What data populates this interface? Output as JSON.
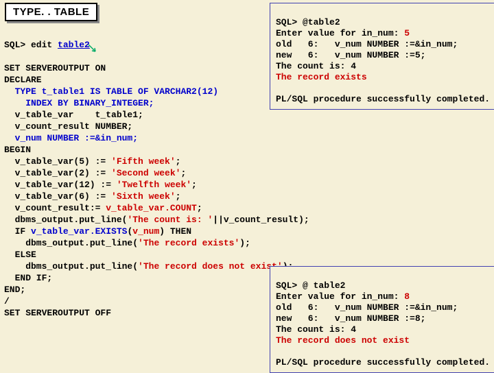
{
  "title": "TYPE. . TABLE",
  "edit_line_prefix": "SQL> edit ",
  "edit_link": "table2",
  "code": {
    "l1": "SET SERVEROUTPUT ON",
    "l2": "DECLARE",
    "l3a": "  TYPE t_table1 IS TABLE OF VARCHAR2(12)",
    "l4": "    INDEX BY BINARY_INTEGER;",
    "l5": "  v_table_var    t_table1;",
    "l6": "  v_count_result NUMBER;",
    "l7": "  v_num NUMBER :=&in_num;",
    "l8": "BEGIN",
    "l9a": "  v_table_var(5) := ",
    "l9b": "'Fifth week'",
    "l10a": "  v_table_var(2) := ",
    "l10b": "'Second week'",
    "l11a": "  v_table_var(12) := ",
    "l11b": "'Twelfth week'",
    "l12a": "  v_table_var(6) := ",
    "l12b": "'Sixth week'",
    "l13a": "  v_count_result:= ",
    "l13b": "v_table_var.COUNT",
    "l14a": "  dbms_output.put_line(",
    "l14b": "'The count is: '",
    "l14c": "||v_count_result);",
    "l15a": "  IF ",
    "l15b": "v_table_var.EXISTS",
    "l15c": "(",
    "l15d": "v_num",
    "l15e": ") THEN",
    "l16a": "    dbms_output.put_line(",
    "l16b": "'The record exists'",
    "l16c": ");",
    "l17": "  ELSE",
    "l18a": "    dbms_output.put_line(",
    "l18b": "'The record does not exist'",
    "l18c": ");",
    "l19": "  END IF;",
    "l20": "END;",
    "l21": "/",
    "l22": "SET SERVEROUTPUT OFF",
    "semi": ";"
  },
  "out1": {
    "l1": "SQL> @table2",
    "l2a": "Enter value for in_num: ",
    "l2b": "5",
    "l3": "old   6:   v_num NUMBER :=&in_num;",
    "l4": "new   6:   v_num NUMBER :=5;",
    "l5": "The count is: 4",
    "l6": "The record exists",
    "l7": "PL/SQL procedure successfully completed."
  },
  "out2": {
    "l1": "SQL> @ table2",
    "l2a": "Enter value for in_num: ",
    "l2b": "8",
    "l3": "old   6:   v_num NUMBER :=&in_num;",
    "l4": "new   6:   v_num NUMBER :=8;",
    "l5": "The count is: 4",
    "l6": "The record does not exist",
    "l7": "PL/SQL procedure successfully completed."
  }
}
